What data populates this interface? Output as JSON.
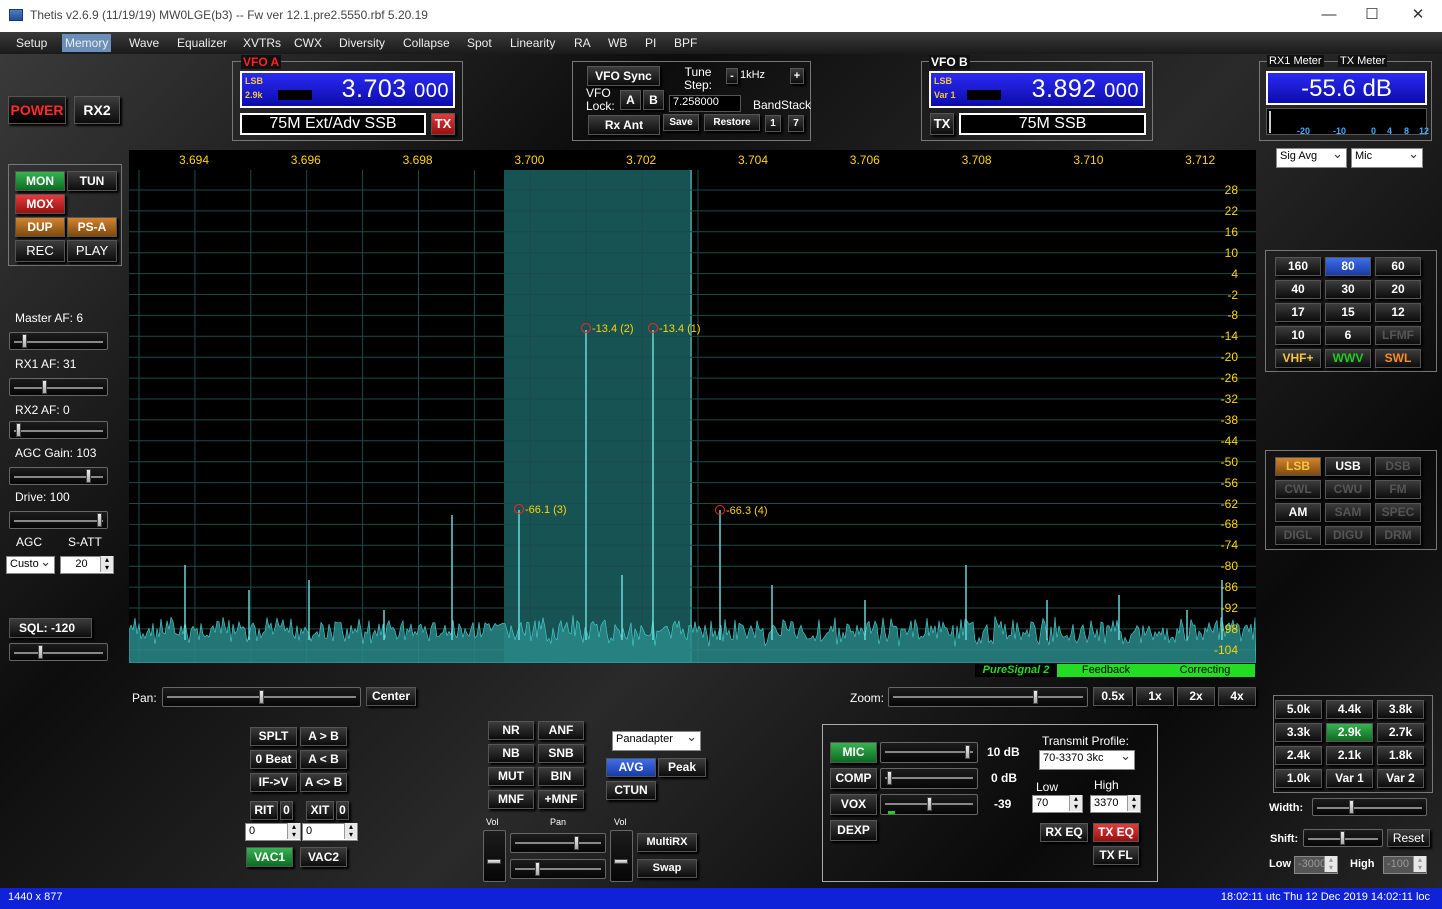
{
  "window": {
    "title": "Thetis v2.6.9 (11/19/19) MW0LGE(b3)   --    Fw ver 12.1.pre2.5550.rbf 5.20.19",
    "minimize": "—",
    "maximize": "☐",
    "close": "✕"
  },
  "menu": [
    "Setup",
    "Memory",
    "Wave",
    "Equalizer",
    "XVTRs",
    "CWX",
    "Diversity",
    "Collapse",
    "Spot",
    "Linearity",
    "RA",
    "WB",
    "PI",
    "BPF"
  ],
  "menu_selected": "Memory",
  "power": {
    "power": "POWER",
    "rx2": "RX2"
  },
  "tx_buttons": {
    "mon": "MON",
    "tun": "TUN",
    "mox": "MOX",
    "dup": "DUP",
    "psa": "PS-A",
    "rec": "REC",
    "play": "PLAY"
  },
  "left": {
    "master_af": "Master AF:  6",
    "rx1_af": "RX1 AF:  31",
    "rx2_af": "RX2 AF:  0",
    "agc_gain": "AGC Gain:  103",
    "drive": "Drive:  100",
    "agc": "AGC",
    "satt": "S-ATT",
    "agc_mode": "Custo",
    "satt_value": "20",
    "sql": "SQL: -120"
  },
  "vfoa": {
    "label": "VFO A",
    "mode": "LSB",
    "bw": "2.9k",
    "freq_mhz": "3.703",
    "freq_hz": "000",
    "band": "75M Ext/Adv SSB",
    "tx": "TX"
  },
  "vfob": {
    "label": "VFO B",
    "mode": "LSB",
    "bw": "Var 1",
    "freq_mhz": "3.892",
    "freq_hz": "000",
    "band": "75M SSB",
    "tx": "TX"
  },
  "vfosync": {
    "sync": "VFO Sync",
    "lock": "VFO\nLock:",
    "a": "A",
    "b": "B",
    "tune_step": "Tune\nStep:",
    "step_val": "1kHz",
    "minus": "-",
    "plus": "+",
    "freq": "7.258000",
    "bandstack": "BandStack",
    "rxant": "Rx Ant",
    "save": "Save",
    "restore": "Restore",
    "bs1": "1",
    "bs2": "7"
  },
  "meters": {
    "rx1": "RX1 Meter",
    "tx": "TX Meter",
    "value": "-55.6 dB",
    "scale": [
      "-20",
      "-10",
      "0",
      "4",
      "8",
      "12"
    ],
    "rx_mode": "Sig Avg",
    "tx_mode": "Mic"
  },
  "bands": [
    "160",
    "80",
    "60",
    "40",
    "30",
    "20",
    "17",
    "15",
    "12",
    "10",
    "6",
    "LFMF",
    "VHF+",
    "WWV",
    "SWL"
  ],
  "modes": [
    "LSB",
    "USB",
    "DSB",
    "CWL",
    "CWU",
    "FM",
    "AM",
    "SAM",
    "SPEC",
    "DIGL",
    "DIGU",
    "DRM"
  ],
  "filters": [
    "5.0k",
    "4.4k",
    "3.8k",
    "3.3k",
    "2.9k",
    "2.7k",
    "2.4k",
    "2.1k",
    "1.8k",
    "1.0k",
    "Var 1",
    "Var 2"
  ],
  "filter_ctrl": {
    "width": "Width:",
    "shift": "Shift:",
    "reset": "Reset",
    "low": "Low",
    "low_val": "-3000",
    "high": "High",
    "high_val": "-100"
  },
  "panadapter": {
    "freq_labels": [
      "3.694",
      "3.696",
      "3.698",
      "3.700",
      "3.702",
      "3.704",
      "3.706",
      "3.708",
      "3.710",
      "3.712"
    ],
    "db_labels": [
      "28",
      "22",
      "16",
      "10",
      "4",
      "-2",
      "-8",
      "-14",
      "-20",
      "-26",
      "-32",
      "-38",
      "-44",
      "-50",
      "-56",
      "-62",
      "-68",
      "-74",
      "-80",
      "-86",
      "-92",
      "-98",
      "-104"
    ],
    "annotations": [
      "-13.4 (2)",
      "-13.4 (1)",
      "-66.1 (3)",
      "-66.3 (4)"
    ],
    "ps_label": "PureSignal 2",
    "feedback": "Feedback",
    "correcting": "Correcting",
    "ps_color": "#22dd22"
  },
  "pan_zoom": {
    "pan": "Pan:",
    "center": "Center",
    "zoom": "Zoom:",
    "z05": "0.5x",
    "z1": "1x",
    "z2": "2x",
    "z4": "4x"
  },
  "split": {
    "splt": "SPLT",
    "atob": "A > B",
    "zerobeat": "0 Beat",
    "btoa": "A < B",
    "ifv": "IF->V",
    "swap": "A <> B",
    "rit": "RIT",
    "rit0": "0",
    "xit": "XIT",
    "xit0": "0",
    "ritv": "0",
    "xitv": "0",
    "vac1": "VAC1",
    "vac2": "VAC2"
  },
  "dsp": {
    "nr": "NR",
    "anf": "ANF",
    "nb": "NB",
    "snb": "SNB",
    "mut": "MUT",
    "bin": "BIN",
    "mnf": "MNF",
    "pmnf": "+MNF",
    "display": "Panadapter",
    "avg": "AVG",
    "peak": "Peak",
    "ctun": "CTUN"
  },
  "rx2ctl": {
    "vol": "Vol",
    "pan": "Pan",
    "vol2": "Vol",
    "multirx": "MultiRX",
    "swap": "Swap"
  },
  "txpanel": {
    "mic": "MIC",
    "mic_val": "10 dB",
    "comp": "COMP",
    "comp_val": "0 dB",
    "vox": "VOX",
    "vox_val": "-39",
    "dexp": "DEXP",
    "profile_label": "Transmit Profile:",
    "profile": "70-3370 3kc",
    "low": "Low",
    "low_val": "70",
    "high": "High",
    "high_val": "3370",
    "rxeq": "RX EQ",
    "txeq": "TX EQ",
    "txfl": "TX FL"
  },
  "statusbar": {
    "left": "1440 x 877",
    "right": "18:02:11 utc   Thu 12 Dec 2019   14:02:11 loc"
  }
}
